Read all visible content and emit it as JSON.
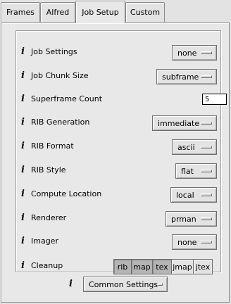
{
  "tabs": [
    {
      "label": "Frames"
    },
    {
      "label": "Alfred"
    },
    {
      "label": "Job Setup",
      "active": true
    },
    {
      "label": "Custom"
    }
  ],
  "info_glyph": "i",
  "rows": {
    "job_settings": {
      "label": "Job Settings",
      "value": "none"
    },
    "job_chunk_size": {
      "label": "Job Chunk Size",
      "value": "subframe"
    },
    "superframe_count": {
      "label": "Superframe Count",
      "value": "5"
    },
    "rib_generation": {
      "label": "RIB Generation",
      "value": "immediate"
    },
    "rib_format": {
      "label": "RIB Format",
      "value": "ascii"
    },
    "rib_style": {
      "label": "RIB Style",
      "value": "flat"
    },
    "compute_location": {
      "label": "Compute Location",
      "value": "local"
    },
    "renderer": {
      "label": "Renderer",
      "value": "prman"
    },
    "imager": {
      "label": "Imager",
      "value": "none"
    },
    "cleanup": {
      "label": "Cleanup",
      "options": [
        {
          "label": "rib",
          "selected": true
        },
        {
          "label": "map",
          "selected": true
        },
        {
          "label": "tex",
          "selected": true
        },
        {
          "label": "jmap",
          "selected": false
        },
        {
          "label": "jtex",
          "selected": false
        }
      ]
    }
  },
  "common_settings": {
    "value": "Common Settings"
  },
  "colors": {
    "background": "#e3e3e3",
    "border": "#8a8a8a",
    "toggle_selected": "#b4b4b4",
    "input_bg": "#ffffff"
  }
}
